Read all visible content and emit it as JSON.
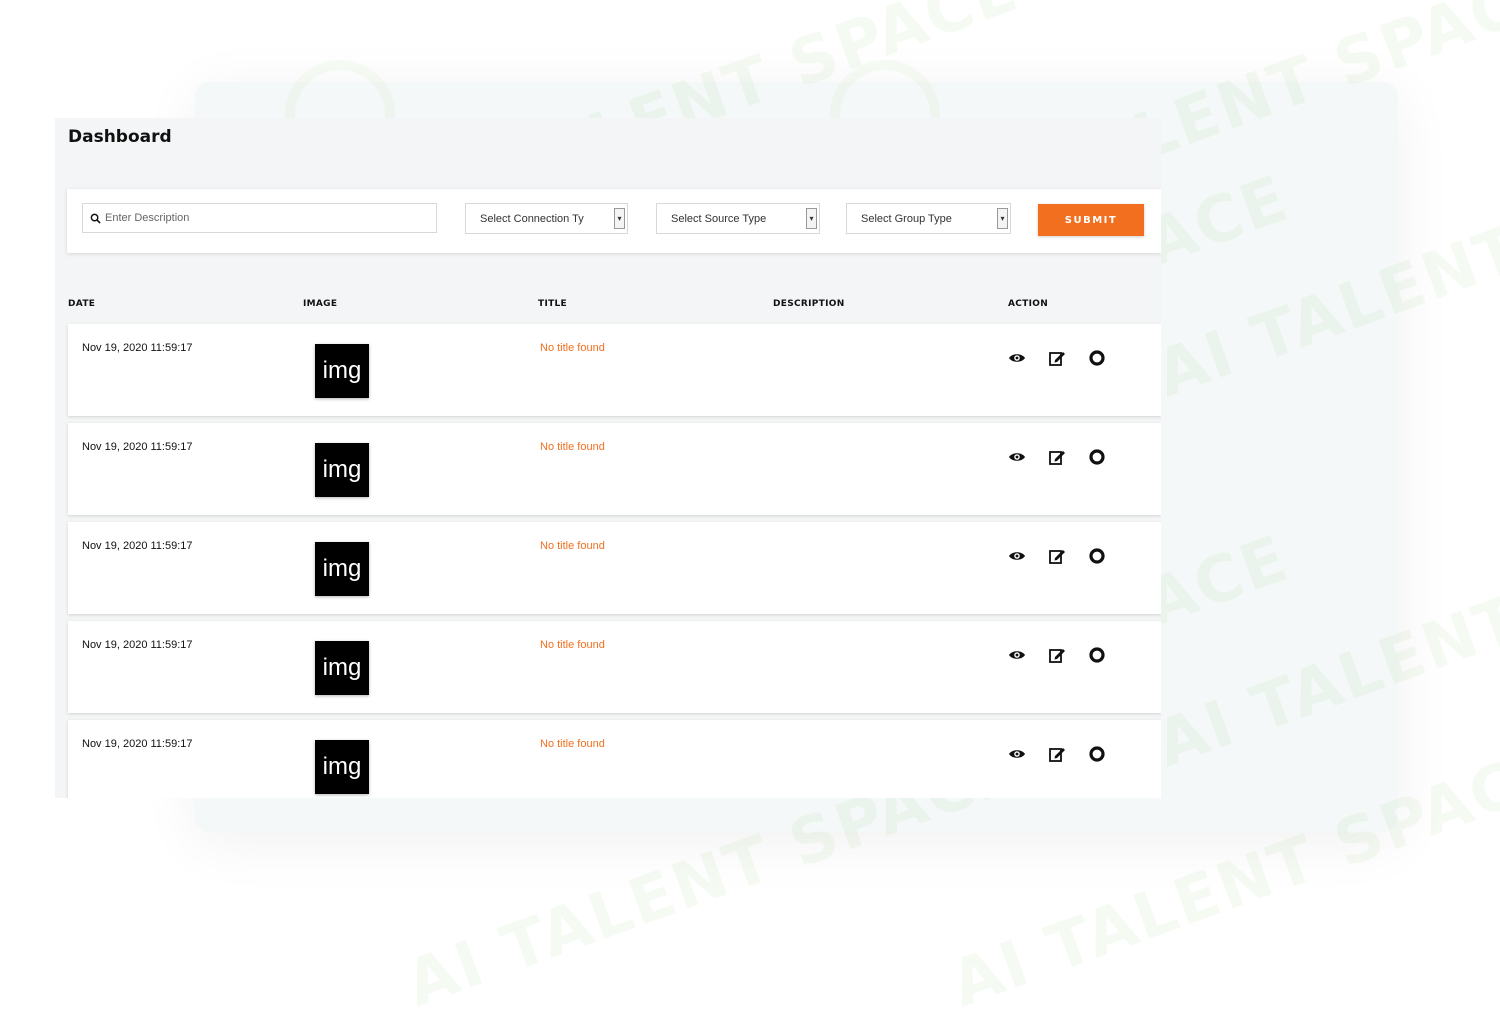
{
  "dashboard": {
    "title": "Dashboard"
  },
  "filters": {
    "search_placeholder": "Enter Description",
    "connection_type": "Select Connection Ty",
    "source_type": "Select Source Type",
    "group_type": "Select Group Type",
    "submit_label": "SUBMIT"
  },
  "table": {
    "columns": {
      "date": "DATE",
      "image": "IMAGE",
      "title": "TITLE",
      "description": "DESCRIPTION",
      "action": "ACTION"
    },
    "rows": [
      {
        "date": "Nov 19, 2020 11:59:17",
        "image_label": "img",
        "title": "No title found",
        "description": ""
      },
      {
        "date": "Nov 19, 2020 11:59:17",
        "image_label": "img",
        "title": "No title found",
        "description": ""
      },
      {
        "date": "Nov 19, 2020 11:59:17",
        "image_label": "img",
        "title": "No title found",
        "description": ""
      },
      {
        "date": "Nov 19, 2020 11:59:17",
        "image_label": "img",
        "title": "No title found",
        "description": ""
      },
      {
        "date": "Nov 19, 2020 11:59:17",
        "image_label": "img",
        "title": "No title found",
        "description": ""
      }
    ],
    "action_icons": [
      "eye-icon",
      "edit-icon",
      "circle-icon"
    ]
  },
  "watermark": {
    "text": "AI TALENT SPACE"
  },
  "colors": {
    "accent": "#f26f1f",
    "panel_bg": "#f3f5f6",
    "row_bg": "#ffffff"
  }
}
